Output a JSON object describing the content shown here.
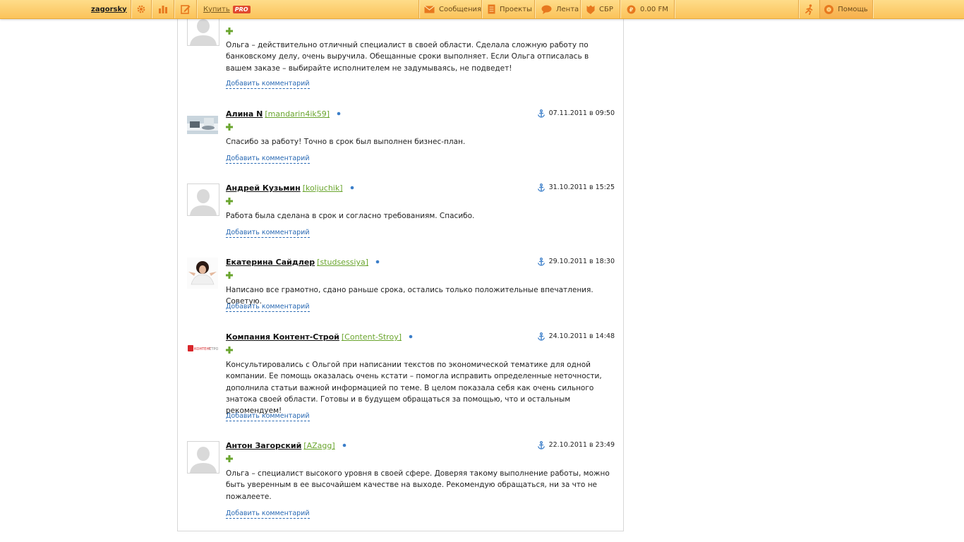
{
  "topbar": {
    "username": "zagorsky",
    "buy_label": "Купить",
    "pro_badge": "PRO",
    "icons": [
      "settings-icon",
      "stats-icon",
      "edit-icon"
    ],
    "nav": {
      "messages": "Сообщения",
      "projects": "Проекты",
      "feed": "Лента",
      "sbr": "СБР",
      "balance": "0.00 FM"
    },
    "help": "Помощь",
    "colors": {
      "bar": "#fbc35a",
      "accent": "#e0492e"
    }
  },
  "reviews": [
    {
      "name": "",
      "login": "",
      "date": "",
      "text": "Ольга – действительно отличный специалист в своей области. Сделала сложную работу по банковскому делу, очень выручила. Обещанные сроки выполняет. Если Ольга отписалась в вашем заказе – выбирайте исполнителем не задумываясь, не подведет!",
      "comment_link": "Добавить комментарий"
    },
    {
      "name": "Алина N",
      "login": "[mandarin4ik59]",
      "date": "07.11.2011  в 09:50",
      "text": "Спасибо за работу! Точно в срок был выполнен бизнес-план.",
      "comment_link": "Добавить комментарий"
    },
    {
      "name": "Андрей Кузьмин",
      "login": "[koljuchik]",
      "date": "31.10.2011  в 15:25",
      "text": "Работа была сделана в срок и согласно требованиям. Спасибо.",
      "comment_link": "Добавить комментарий"
    },
    {
      "name": "Екатерина Сайдлер",
      "login": "[studsessiya]",
      "date": "29.10.2011  в 18:30",
      "text": "Написано все грамотно, сдано раньше срока, остались только положительные впечатления. Советую.",
      "comment_link": "Добавить комментарий"
    },
    {
      "name": "Компания Контент-Строй",
      "login": "[Content-Stroy]",
      "date": "24.10.2011  в 14:48",
      "text": "Консультировались с Ольгой при написании текстов по экономической тематике для одной компании. Ее помощь оказалась очень кстати – помогла исправить определенные неточности, дополнила статьи важной информацией по теме. В целом показала себя как очень сильного знатока своей области. Готовы и в будущем обращаться за помощью, что и остальным рекомендуем!",
      "comment_link": "Добавить комментарий"
    },
    {
      "name": "Антон Загорский",
      "login": "[AZagg]",
      "date": "22.10.2011  в 23:49",
      "text": "Ольга – специалист высокого уровня в своей сфере. Доверяя такому выполнение работы, можно быть уверенным в ее высочайшем качестве на выходе. Рекомендую обращаться, ни за что не пожалеете.",
      "comment_link": "Добавить комментарий"
    }
  ]
}
